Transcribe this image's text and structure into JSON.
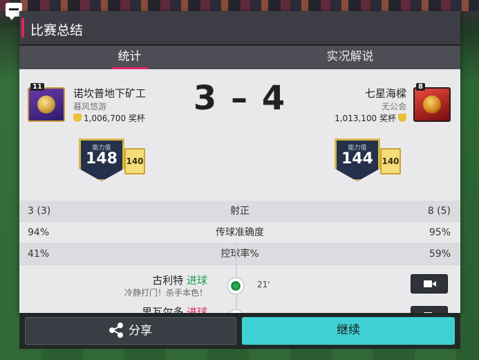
{
  "header": {
    "title": "比赛总结"
  },
  "tabs": [
    {
      "label": "统计",
      "active": true
    },
    {
      "label": "实况解说",
      "active": false
    }
  ],
  "home": {
    "badge_level": "11",
    "name": "诺坎普地下矿工",
    "subtitle": "暮风悠游",
    "fans": "1,006,700 奖杯",
    "rating_label": "能力值",
    "rating": "148",
    "mini_rating": "140"
  },
  "away": {
    "badge_level": "8",
    "name": "七星海樑",
    "subtitle": "无公会",
    "fans": "1,013,100 奖杯",
    "rating_label": "能力值",
    "rating": "144",
    "mini_rating": "140"
  },
  "score": "3 – 4",
  "stats": [
    {
      "label": "射正",
      "home": "3 (3)",
      "away": "8 (5)"
    },
    {
      "label": "传球准确度",
      "home": "94%",
      "away": "95%"
    },
    {
      "label": "控球率%",
      "home": "41%",
      "away": "59%"
    }
  ],
  "events": [
    {
      "player": "古利特",
      "type": "进球",
      "desc": "冷静打门！杀手本色！",
      "minute": "21'"
    },
    {
      "player": "男瓦尔多",
      "type": "进球",
      "desc": "",
      "minute": ""
    }
  ],
  "buttons": {
    "share": "分享",
    "continue": "继续"
  },
  "colors": {
    "accent": "#e0245e",
    "continue": "#3fd0d4",
    "goal_green": "#1fa24a"
  }
}
